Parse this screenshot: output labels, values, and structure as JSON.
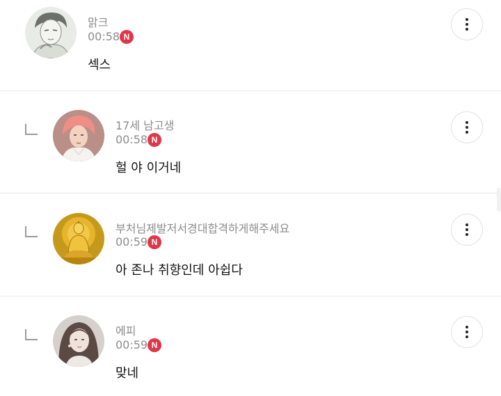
{
  "badge_label": "N",
  "badge_color": "#e0364a",
  "comments": [
    {
      "author": "맑크",
      "time": "00:58",
      "text": "섹스",
      "is_reply": false,
      "avatar_icon": "manga-boy-avatar"
    },
    {
      "author": "17세 남고생",
      "time": "00:58",
      "text": "헐 야 이거네",
      "is_reply": true,
      "avatar_icon": "pink-hair-man-avatar"
    },
    {
      "author": "부처님제발저서경대합격하게해주세요",
      "time": "00:59",
      "text": "아 존나 취향인데 아쉽다",
      "is_reply": true,
      "avatar_icon": "golden-buddha-avatar"
    },
    {
      "author": "에피",
      "time": "00:59",
      "text": "맞네",
      "is_reply": true,
      "avatar_icon": "woman-portrait-avatar"
    }
  ]
}
